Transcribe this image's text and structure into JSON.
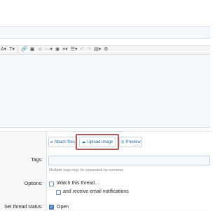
{
  "title_input": {
    "value": ""
  },
  "toolbar": {
    "items": [
      "A▾",
      "T▾",
      "🔗",
      "▣",
      "☺",
      "⋯▾",
      "◉",
      "≡▾",
      "☰▾",
      "↶",
      "↷",
      "▤▾",
      "⚙"
    ]
  },
  "attachments": {
    "attach_files_label": "Attach files",
    "upload_image_label": "Upload image",
    "preview_label": "Preview"
  },
  "tags": {
    "label": "Tags:",
    "hint": "Multiple tags may be separated by commas."
  },
  "options": {
    "label": "Options:",
    "watch_label": "Watch this thread…",
    "email_label": "and receive email notifications"
  },
  "status": {
    "label": "Set thread status:",
    "open_label": "Open"
  },
  "colors": {
    "highlight": "#b05a58",
    "link": "#2b6ca3",
    "editor_bg": "#f4f8fc"
  }
}
